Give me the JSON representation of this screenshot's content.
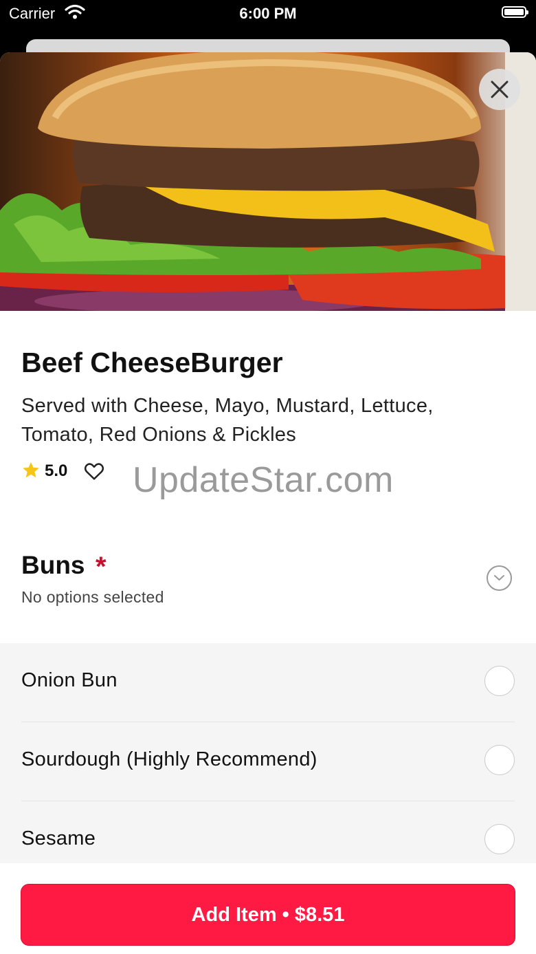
{
  "status_bar": {
    "carrier": "Carrier",
    "time": "6:00 PM"
  },
  "product": {
    "name": "Beef CheeseBurger",
    "description": "Served with Cheese, Mayo, Mustard, Lettuce, Tomato, Red Onions & Pickles",
    "rating": "5.0",
    "image": "cheeseburger-photo"
  },
  "watermark": "UpdateStar.com",
  "buns": {
    "title": "Buns",
    "required_marker": "*",
    "status": "No options selected",
    "options": [
      {
        "label": "Onion Bun",
        "selected": false
      },
      {
        "label": "Sourdough (Highly Recommend)",
        "selected": false
      },
      {
        "label": "Sesame",
        "selected": false
      }
    ]
  },
  "footer": {
    "add_button": "Add Item • $8.51"
  },
  "icons": {
    "close": "close-icon",
    "star": "star-icon",
    "heart": "heart-icon",
    "chevron": "chevron-down-icon",
    "wifi": "wifi-icon",
    "battery": "battery-icon"
  },
  "colors": {
    "accent": "#ff1a43",
    "required": "#c8102e",
    "star": "#f5c518"
  }
}
